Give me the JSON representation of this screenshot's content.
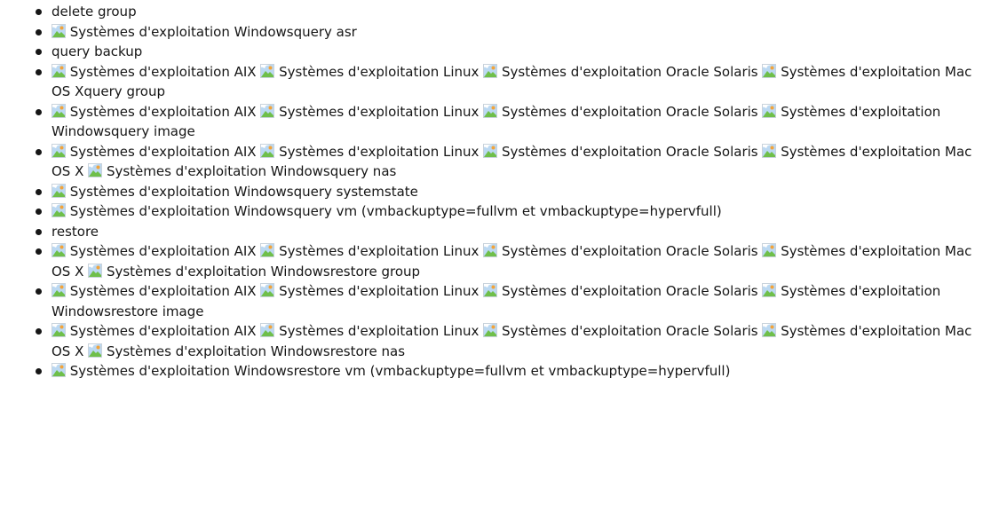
{
  "items": [
    {
      "segments": [
        {
          "img": false,
          "text": "delete group"
        }
      ]
    },
    {
      "segments": [
        {
          "img": true,
          "text": "Systèmes d'exploitation Windowsquery asr"
        }
      ]
    },
    {
      "segments": [
        {
          "img": false,
          "text": "query backup"
        }
      ]
    },
    {
      "segments": [
        {
          "img": true,
          "text": "Systèmes d'exploitation AIX"
        },
        {
          "img": true,
          "text": "Systèmes d'exploitation Linux"
        },
        {
          "img": true,
          "text": "Systèmes d'exploitation Oracle Solaris"
        },
        {
          "img": true,
          "text": "Systèmes d'exploitation Mac OS Xquery group"
        }
      ]
    },
    {
      "segments": [
        {
          "img": true,
          "text": "Systèmes d'exploitation AIX"
        },
        {
          "img": true,
          "text": "Systèmes d'exploitation Linux"
        },
        {
          "img": true,
          "text": "Systèmes d'exploitation Oracle Solaris"
        },
        {
          "img": true,
          "text": "Systèmes d'exploitation Windowsquery image"
        }
      ]
    },
    {
      "segments": [
        {
          "img": true,
          "text": "Systèmes d'exploitation AIX"
        },
        {
          "img": true,
          "text": "Systèmes d'exploitation Linux"
        },
        {
          "img": true,
          "text": "Systèmes d'exploitation Oracle Solaris"
        },
        {
          "img": true,
          "text": "Systèmes d'exploitation Mac OS X"
        },
        {
          "img": true,
          "text": "Systèmes d'exploitation Windowsquery nas"
        }
      ]
    },
    {
      "segments": [
        {
          "img": true,
          "text": "Systèmes d'exploitation Windowsquery systemstate"
        }
      ]
    },
    {
      "segments": [
        {
          "img": true,
          "text": "Systèmes d'exploitation Windowsquery vm (vmbackuptype=fullvm et vmbackuptype=hypervfull)"
        }
      ]
    },
    {
      "segments": [
        {
          "img": false,
          "text": "restore"
        }
      ]
    },
    {
      "segments": [
        {
          "img": true,
          "text": "Systèmes d'exploitation AIX"
        },
        {
          "img": true,
          "text": "Systèmes d'exploitation Linux"
        },
        {
          "img": true,
          "text": "Systèmes d'exploitation Oracle Solaris"
        },
        {
          "img": true,
          "text": "Systèmes d'exploitation Mac OS X"
        },
        {
          "img": true,
          "text": "Systèmes d'exploitation Windowsrestore group"
        }
      ]
    },
    {
      "segments": [
        {
          "img": true,
          "text": "Systèmes d'exploitation AIX"
        },
        {
          "img": true,
          "text": "Systèmes d'exploitation Linux"
        },
        {
          "img": true,
          "text": "Systèmes d'exploitation Oracle Solaris"
        },
        {
          "img": true,
          "text": "Systèmes d'exploitation Windowsrestore image"
        }
      ]
    },
    {
      "segments": [
        {
          "img": true,
          "text": "Systèmes d'exploitation AIX"
        },
        {
          "img": true,
          "text": "Systèmes d'exploitation Linux"
        },
        {
          "img": true,
          "text": "Systèmes d'exploitation Oracle Solaris"
        },
        {
          "img": true,
          "text": "Systèmes d'exploitation Mac OS X"
        },
        {
          "img": true,
          "text": "Systèmes d'exploitation Windowsrestore nas"
        }
      ]
    },
    {
      "segments": [
        {
          "img": true,
          "text": "Systèmes d'exploitation Windowsrestore vm (vmbackuptype=fullvm et vmbackuptype=hypervfull)"
        }
      ]
    }
  ],
  "icon": "broken-image-icon",
  "colors": {
    "text": "#161616",
    "icon_sky": "#bcd9f2",
    "icon_hill": "#6fbf4a",
    "icon_sun": "#f2a33a"
  }
}
